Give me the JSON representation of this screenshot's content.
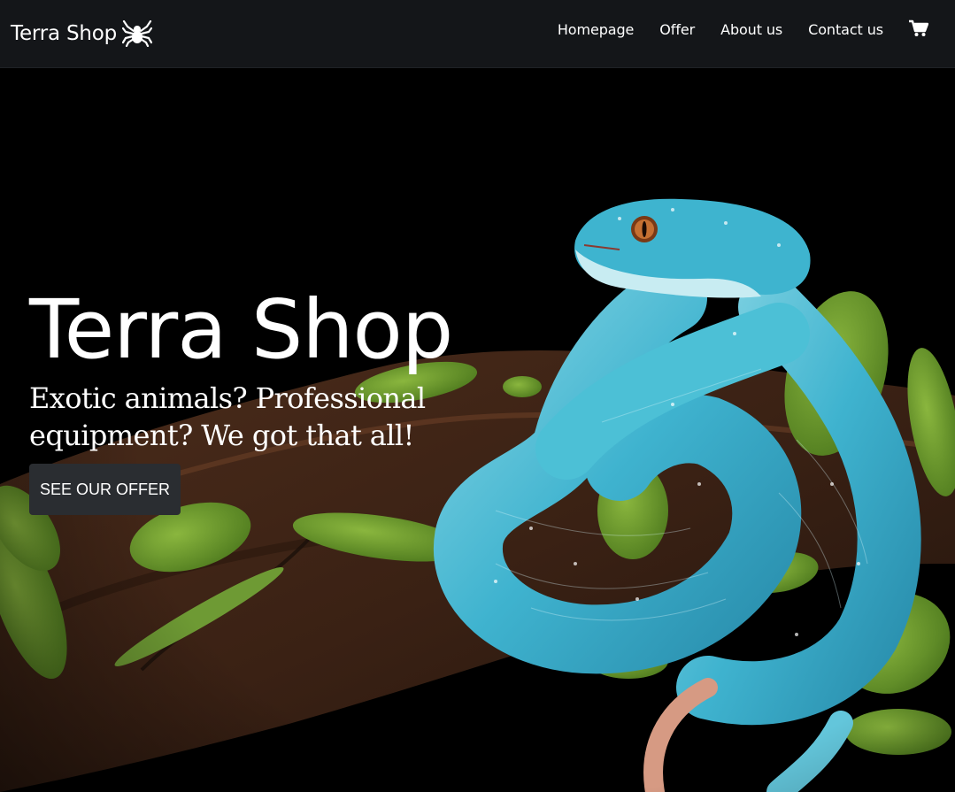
{
  "nav": {
    "brand": "Terra Shop",
    "brand_icon": "spider-icon",
    "links": [
      "Homepage",
      "Offer",
      "About us",
      "Contact us"
    ],
    "cart_icon": "shopping-cart-icon",
    "background": "#141619"
  },
  "hero": {
    "title": "Terra Shop",
    "subtitle": "Exotic animals? Professional equipment? We got that all!",
    "cta": "SEE OUR OFFER",
    "image_icon": "snake-on-branch-photo",
    "cta_background": "#2a2d31"
  }
}
